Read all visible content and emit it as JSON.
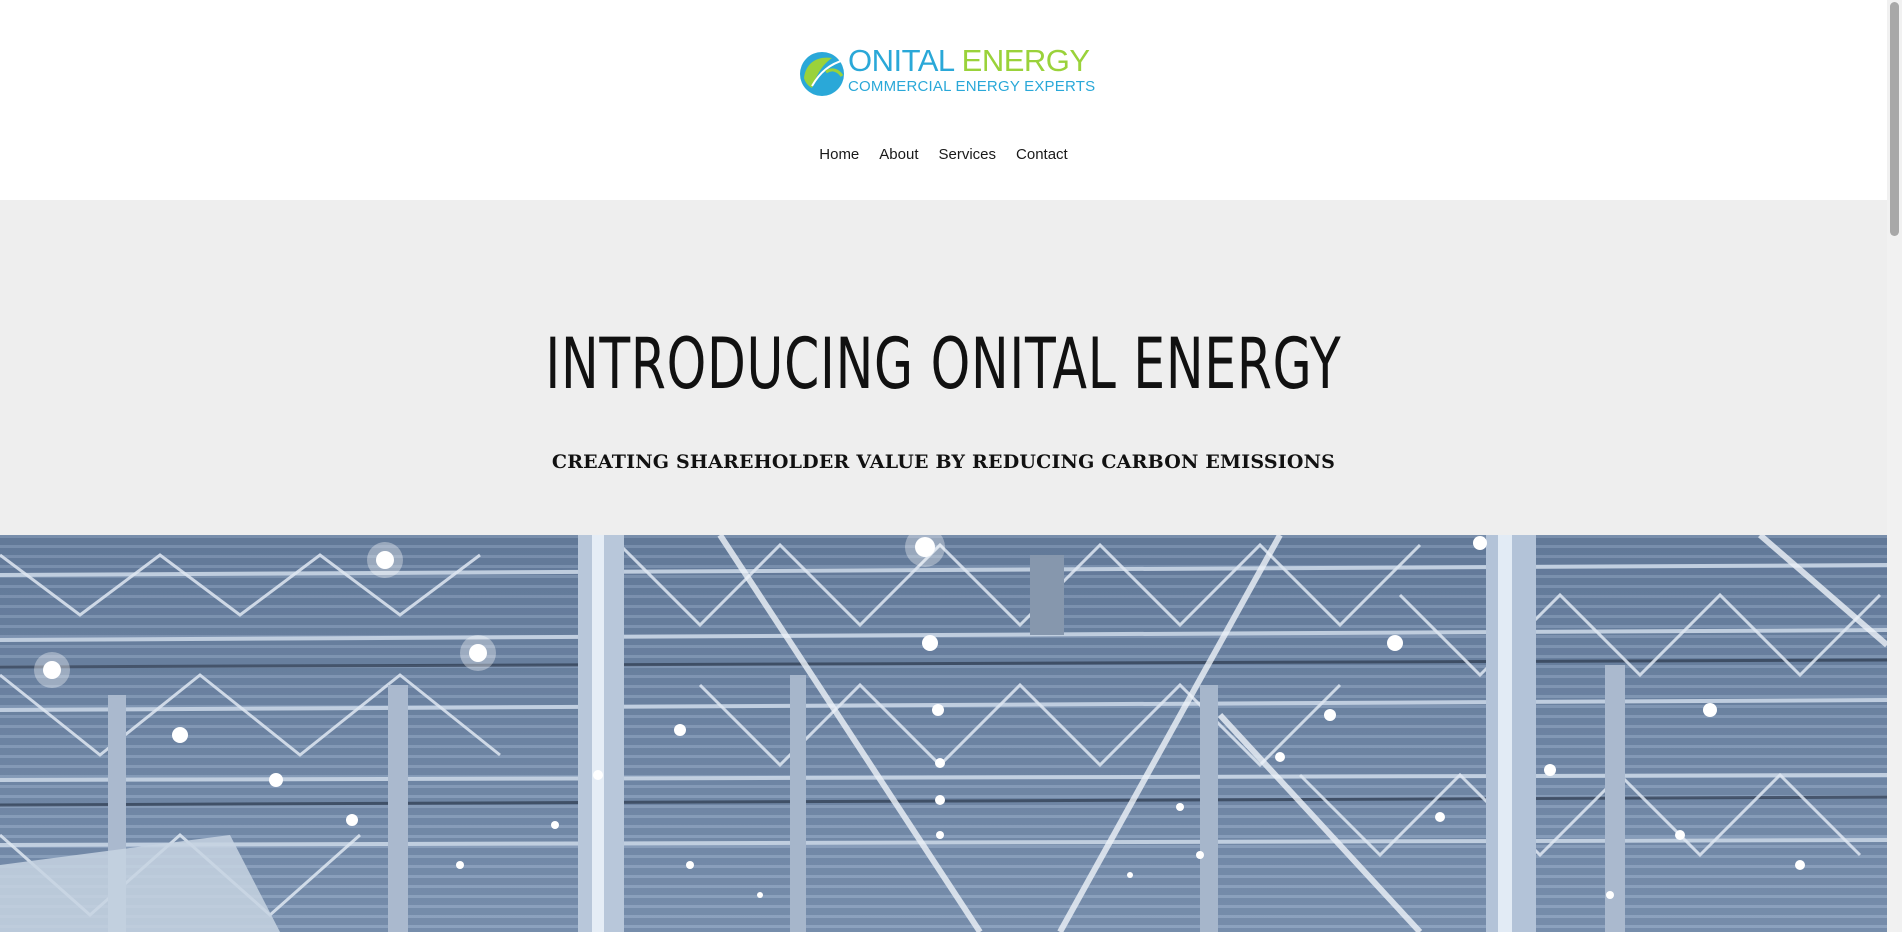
{
  "header": {
    "logo": {
      "word1": "ONITAL",
      "word2": "ENERGY",
      "tagline": "COMMERCIAL ENERGY EXPERTS",
      "icon": "leaf-globe-icon",
      "colors": {
        "blue": "#2aa8d8",
        "green": "#9ad23a"
      }
    },
    "nav": [
      {
        "label": "Home"
      },
      {
        "label": "About"
      },
      {
        "label": "Services"
      },
      {
        "label": "Contact"
      }
    ]
  },
  "intro": {
    "title": "INTRODUCING ONITAL ENERGY",
    "subtitle": "CREATING SHAREHOLDER VALUE BY REDUCING CARBON EMISSIONS",
    "background": "#eeeeee"
  },
  "hero": {
    "image": "warehouse-ceiling-steel-trusses-lights"
  }
}
